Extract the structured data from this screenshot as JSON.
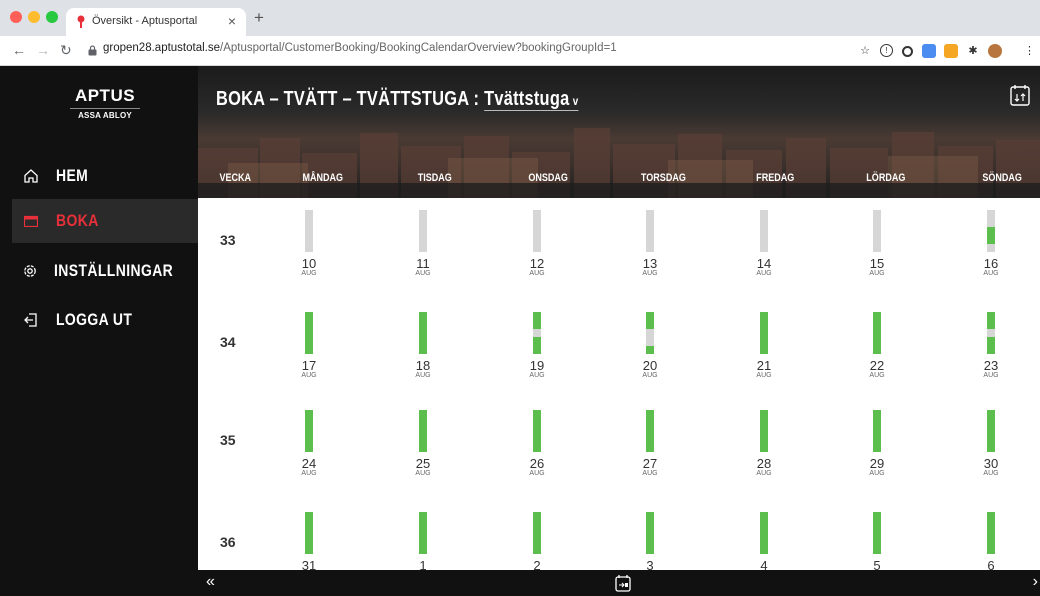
{
  "browser": {
    "tab_title": "Översikt - Aptusportal",
    "url_host": "gropen28.aptustotal.se",
    "url_path": "/Aptusportal/CustomerBooking/BookingCalendarOverview?bookingGroupId=1"
  },
  "sidebar": {
    "brand": "APTUS",
    "brand_sub": "ASSA ABLOY",
    "items": [
      {
        "label": "HEM",
        "icon": "home-icon",
        "active": false
      },
      {
        "label": "BOKA",
        "icon": "calendar-icon",
        "active": true
      },
      {
        "label": "INSTÄLLNINGAR",
        "icon": "gear-icon",
        "active": false
      },
      {
        "label": "LOGGA UT",
        "icon": "logout-icon",
        "active": false
      }
    ]
  },
  "header": {
    "title_prefix": "BOKA – TVÄTT – TVÄTTSTUGA : ",
    "title_select": "Tvättstuga",
    "week_col": "VECKA",
    "days": [
      "MÅNDAG",
      "TISDAG",
      "ONSDAG",
      "TORSDAG",
      "FREDAG",
      "LÖRDAG",
      "SÖNDAG"
    ]
  },
  "colors": {
    "available": "#5cbe4c",
    "unavailable": "#d6d6d6",
    "accent": "#e8303a"
  },
  "weeks": [
    {
      "week": "33",
      "days": [
        {
          "date": "10",
          "month": "AUG",
          "avail": 0
        },
        {
          "date": "11",
          "month": "AUG",
          "avail": 0
        },
        {
          "date": "12",
          "month": "AUG",
          "avail": 0
        },
        {
          "date": "13",
          "month": "AUG",
          "avail": 0
        },
        {
          "date": "14",
          "month": "AUG",
          "avail": 0
        },
        {
          "date": "15",
          "month": "AUG",
          "avail": 0
        },
        {
          "date": "16",
          "month": "AUG",
          "avail": 0.4
        }
      ]
    },
    {
      "week": "34",
      "days": [
        {
          "date": "17",
          "month": "AUG",
          "avail": 1
        },
        {
          "date": "18",
          "month": "AUG",
          "avail": 1
        },
        {
          "date": "19",
          "month": "AUG",
          "avail": 0.8
        },
        {
          "date": "20",
          "month": "AUG",
          "avail": 0.6
        },
        {
          "date": "21",
          "month": "AUG",
          "avail": 1
        },
        {
          "date": "22",
          "month": "AUG",
          "avail": 1
        },
        {
          "date": "23",
          "month": "AUG",
          "avail": 0.8
        }
      ]
    },
    {
      "week": "35",
      "days": [
        {
          "date": "24",
          "month": "AUG",
          "avail": 1
        },
        {
          "date": "25",
          "month": "AUG",
          "avail": 1
        },
        {
          "date": "26",
          "month": "AUG",
          "avail": 1
        },
        {
          "date": "27",
          "month": "AUG",
          "avail": 1
        },
        {
          "date": "28",
          "month": "AUG",
          "avail": 1
        },
        {
          "date": "29",
          "month": "AUG",
          "avail": 1
        },
        {
          "date": "30",
          "month": "AUG",
          "avail": 1
        }
      ]
    },
    {
      "week": "36",
      "days": [
        {
          "date": "31",
          "month": "",
          "avail": 1
        },
        {
          "date": "1",
          "month": "",
          "avail": 1
        },
        {
          "date": "2",
          "month": "",
          "avail": 1
        },
        {
          "date": "3",
          "month": "",
          "avail": 1
        },
        {
          "date": "4",
          "month": "",
          "avail": 1
        },
        {
          "date": "5",
          "month": "",
          "avail": 1
        },
        {
          "date": "6",
          "month": "",
          "avail": 1
        }
      ]
    }
  ],
  "footer": {
    "prev": "«",
    "next": "›"
  }
}
